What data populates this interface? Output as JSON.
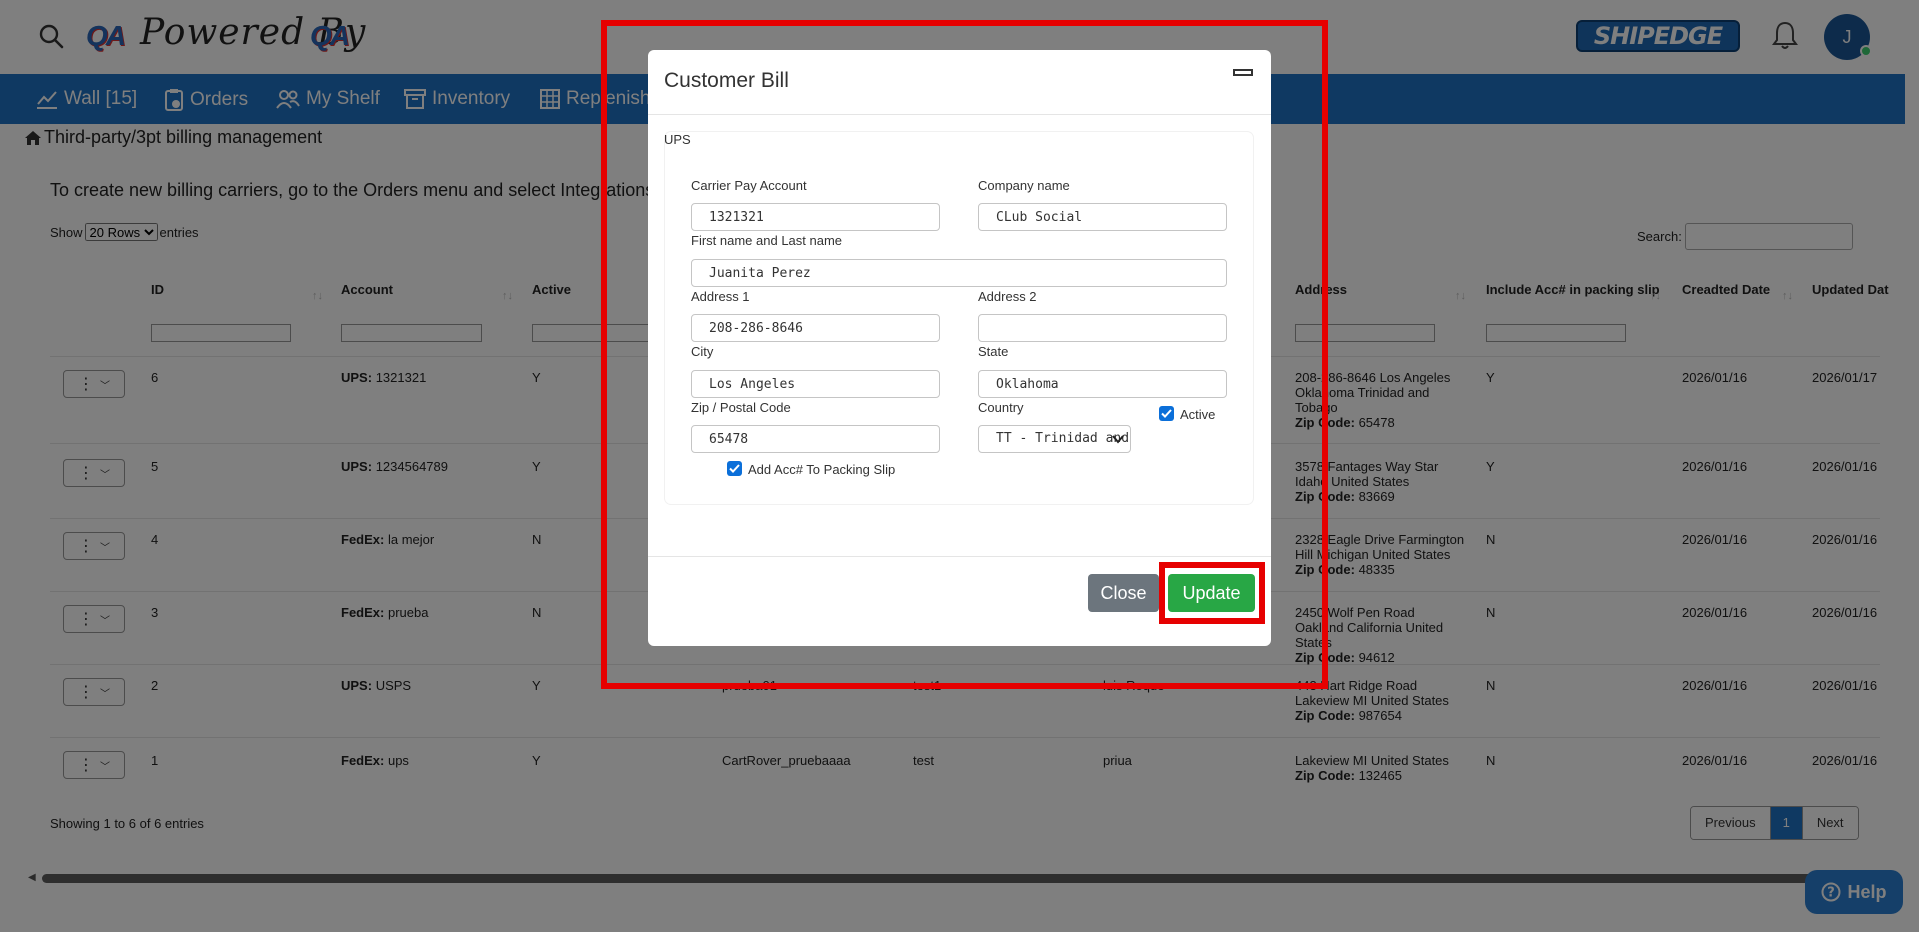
{
  "header": {
    "logo_qa": "QA",
    "powered_text": "Powered By",
    "brand": "SHIPEDGE",
    "avatar_initial": "J"
  },
  "nav": [
    {
      "label": "Wall [15]",
      "icon": "chart-icon"
    },
    {
      "label": "Orders",
      "icon": "clipboard-clock-icon"
    },
    {
      "label": "My Shelf",
      "icon": "users-icon"
    },
    {
      "label": "Inventory",
      "icon": "archive-icon"
    },
    {
      "label": "Replenish",
      "icon": "grid-icon"
    }
  ],
  "page": {
    "breadcrumb": "Third-party/3pt billing management",
    "info": "To create new billing carriers, go to the Orders menu and select Integrations",
    "show_label": "Show",
    "rows_option": "20 Rows",
    "entries_label": "entries",
    "search_label": "Search:",
    "showing": "Showing 1 to 6 of 6 entries"
  },
  "table": {
    "columns": [
      "ID",
      "Account",
      "Active",
      "Address",
      "Include Acc# in packing slip",
      "Creadted Date",
      "Updated Dat"
    ],
    "rows": [
      {
        "id": "6",
        "carrier": "UPS:",
        "account": "1321321",
        "active": "Y",
        "c4": "",
        "c5": "",
        "c6": "",
        "address": "208-286-8646 Los Angeles Oklahoma Trinidad and Tobago",
        "zip_label": "Zip Code:",
        "zip": "65478",
        "include": "Y",
        "created": "2026/01/16",
        "updated": "2026/01/17"
      },
      {
        "id": "5",
        "carrier": "UPS:",
        "account": "1234564789",
        "active": "Y",
        "c4": "",
        "c5": "",
        "c6": "",
        "address": "3578 Fantages Way Star Idaho United States",
        "zip_label": "Zip Code:",
        "zip": "83669",
        "include": "Y",
        "created": "2026/01/16",
        "updated": "2026/01/16"
      },
      {
        "id": "4",
        "carrier": "FedEx:",
        "account": "la mejor",
        "active": "N",
        "c4": "",
        "c5": "",
        "c6": "",
        "address": "2328 Eagle Drive Farmington Hill Michigan United States",
        "zip_label": "Zip Code:",
        "zip": "48335",
        "include": "N",
        "created": "2026/01/16",
        "updated": "2026/01/16"
      },
      {
        "id": "3",
        "carrier": "FedEx:",
        "account": "prueba",
        "active": "N",
        "c4": "",
        "c5": "",
        "c6": "",
        "address": "2450 Wolf Pen Road Oakland California United States",
        "zip_label": "Zip Code:",
        "zip": "94612",
        "include": "N",
        "created": "2026/01/16",
        "updated": "2026/01/16"
      },
      {
        "id": "2",
        "carrier": "UPS:",
        "account": "USPS",
        "active": "Y",
        "c4": "prueba01",
        "c5": "test1",
        "c6": "luis Roque",
        "address": "443 Hart Ridge Road Lakeview MI United States",
        "zip_label": "Zip Code:",
        "zip": "987654",
        "include": "N",
        "created": "2026/01/16",
        "updated": "2026/01/16"
      },
      {
        "id": "1",
        "carrier": "FedEx:",
        "account": "ups",
        "active": "Y",
        "c4": "CartRover_pruebaaaa",
        "c5": "test",
        "c6": "priua",
        "address": "Lakeview MI United States",
        "zip_label": "Zip Code:",
        "zip": "132465",
        "include": "N",
        "created": "2026/01/16",
        "updated": "2026/01/16"
      }
    ]
  },
  "pager": {
    "previous": "Previous",
    "current": "1",
    "next": "Next"
  },
  "help": {
    "label": "Help"
  },
  "modal": {
    "title": "Customer Bill",
    "section": "UPS",
    "fields": {
      "carrier_pay_account": {
        "label": "Carrier Pay Account",
        "value": "1321321"
      },
      "company_name": {
        "label": "Company name",
        "value": "CLub Social"
      },
      "full_name": {
        "label": "First name and Last name",
        "value": "Juanita Perez"
      },
      "address1": {
        "label": "Address 1",
        "value": "208-286-8646"
      },
      "address2": {
        "label": "Address 2",
        "value": ""
      },
      "city": {
        "label": "City",
        "value": "Los Angeles"
      },
      "state": {
        "label": "State",
        "value": "Oklahoma"
      },
      "zip": {
        "label": "Zip / Postal Code",
        "value": "65478"
      },
      "country": {
        "label": "Country",
        "value": "TT - Trinidad and Tobago"
      }
    },
    "active_label": "Active",
    "packing_slip_label": "Add Acc# To Packing Slip",
    "close_label": "Close",
    "update_label": "Update",
    "colors": {
      "update": "#28a745",
      "close": "#6c757d",
      "checkbox": "#0b6fd9"
    }
  },
  "colors": {
    "nav": "#1f72c4",
    "highlight": "#e60000"
  }
}
